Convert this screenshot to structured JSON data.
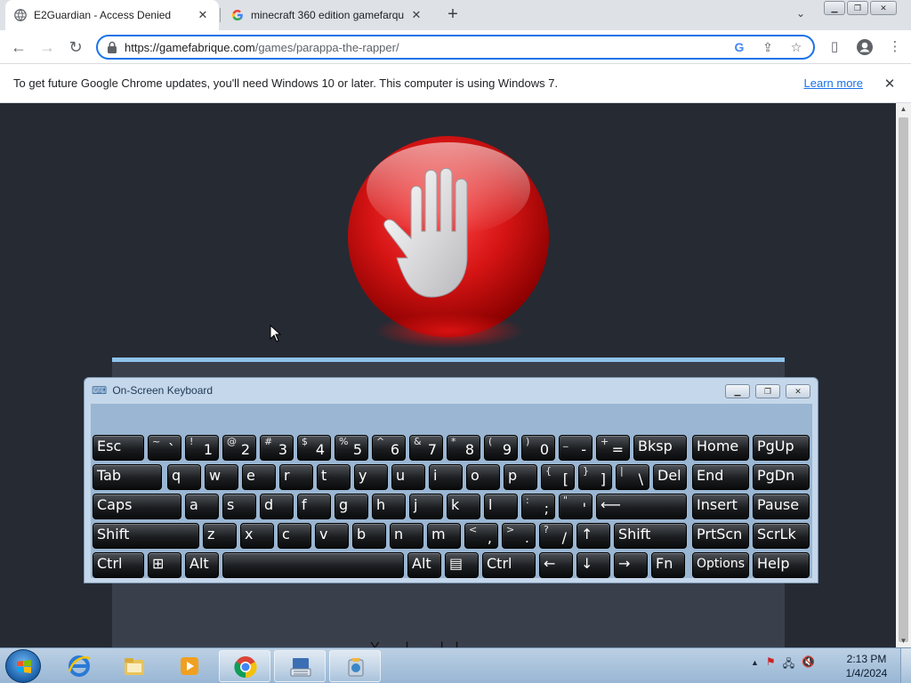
{
  "browser": {
    "tabs": [
      {
        "title": "E2Guardian - Access Denied",
        "active": true,
        "icon": "globe-icon"
      },
      {
        "title": "minecraft 360 edition gamefarqu",
        "active": false,
        "icon": "google-icon"
      }
    ],
    "new_tab_label": "+",
    "url_host": "https://gamefabrique.com",
    "url_path": "/games/parappa-the-rapper/"
  },
  "infobar": {
    "message": "To get future Google Chrome updates, you'll need Windows 10 or later. This computer is using Windows 7.",
    "link": "Learn more"
  },
  "page": {
    "partial_text": "Y...... l... ....l...l"
  },
  "osk": {
    "title": "On-Screen Keyboard",
    "rows": [
      [
        {
          "main": "Esc"
        },
        {
          "top": "~",
          "bot": "`"
        },
        {
          "top": "!",
          "bot": "1"
        },
        {
          "top": "@",
          "bot": "2"
        },
        {
          "top": "#",
          "bot": "3"
        },
        {
          "top": "$",
          "bot": "4"
        },
        {
          "top": "%",
          "bot": "5"
        },
        {
          "top": "^",
          "bot": "6"
        },
        {
          "top": "&",
          "bot": "7"
        },
        {
          "top": "*",
          "bot": "8"
        },
        {
          "top": "(",
          "bot": "9"
        },
        {
          "top": ")",
          "bot": "0"
        },
        {
          "top": "_",
          "bot": "-"
        },
        {
          "top": "+",
          "bot": "="
        },
        {
          "main": "Bksp"
        },
        {
          "main": "Home"
        },
        {
          "main": "PgUp"
        }
      ],
      [
        {
          "main": "Tab"
        },
        {
          "main": "q"
        },
        {
          "main": "w"
        },
        {
          "main": "e"
        },
        {
          "main": "r"
        },
        {
          "main": "t"
        },
        {
          "main": "y"
        },
        {
          "main": "u"
        },
        {
          "main": "i"
        },
        {
          "main": "o"
        },
        {
          "main": "p"
        },
        {
          "top": "{",
          "bot": "["
        },
        {
          "top": "}",
          "bot": "]"
        },
        {
          "top": "|",
          "bot": "\\"
        },
        {
          "main": "Del"
        },
        {
          "main": "End"
        },
        {
          "main": "PgDn"
        }
      ],
      [
        {
          "main": "Caps"
        },
        {
          "main": "a"
        },
        {
          "main": "s"
        },
        {
          "main": "d"
        },
        {
          "main": "f"
        },
        {
          "main": "g"
        },
        {
          "main": "h"
        },
        {
          "main": "j"
        },
        {
          "main": "k"
        },
        {
          "main": "l"
        },
        {
          "top": ":",
          "bot": ";"
        },
        {
          "top": "\"",
          "bot": "'"
        },
        {
          "main": "⟵"
        },
        {
          "main": "Insert"
        },
        {
          "main": "Pause"
        }
      ],
      [
        {
          "main": "Shift"
        },
        {
          "main": "z"
        },
        {
          "main": "x"
        },
        {
          "main": "c"
        },
        {
          "main": "v"
        },
        {
          "main": "b"
        },
        {
          "main": "n"
        },
        {
          "main": "m"
        },
        {
          "top": "<",
          "bot": ","
        },
        {
          "top": ">",
          "bot": "."
        },
        {
          "top": "?",
          "bot": "/"
        },
        {
          "main": "↑"
        },
        {
          "main": "Shift"
        },
        {
          "main": "PrtScn"
        },
        {
          "main": "ScrLk"
        }
      ],
      [
        {
          "main": "Ctrl"
        },
        {
          "main": "⊞"
        },
        {
          "main": "Alt"
        },
        {
          "main": ""
        },
        {
          "main": "Alt"
        },
        {
          "main": "▤"
        },
        {
          "main": "Ctrl"
        },
        {
          "main": "←"
        },
        {
          "main": "↓"
        },
        {
          "main": "→"
        },
        {
          "main": "Fn"
        },
        {
          "main": "Options"
        },
        {
          "main": "Help"
        }
      ]
    ]
  },
  "taskbar": {
    "time": "2:13 PM",
    "date": "1/4/2024",
    "tray_arrow": "▲"
  },
  "colors": {
    "page_bg": "#262a33",
    "accent_blue": "#1a73e8",
    "stop_red": "#d61414"
  }
}
